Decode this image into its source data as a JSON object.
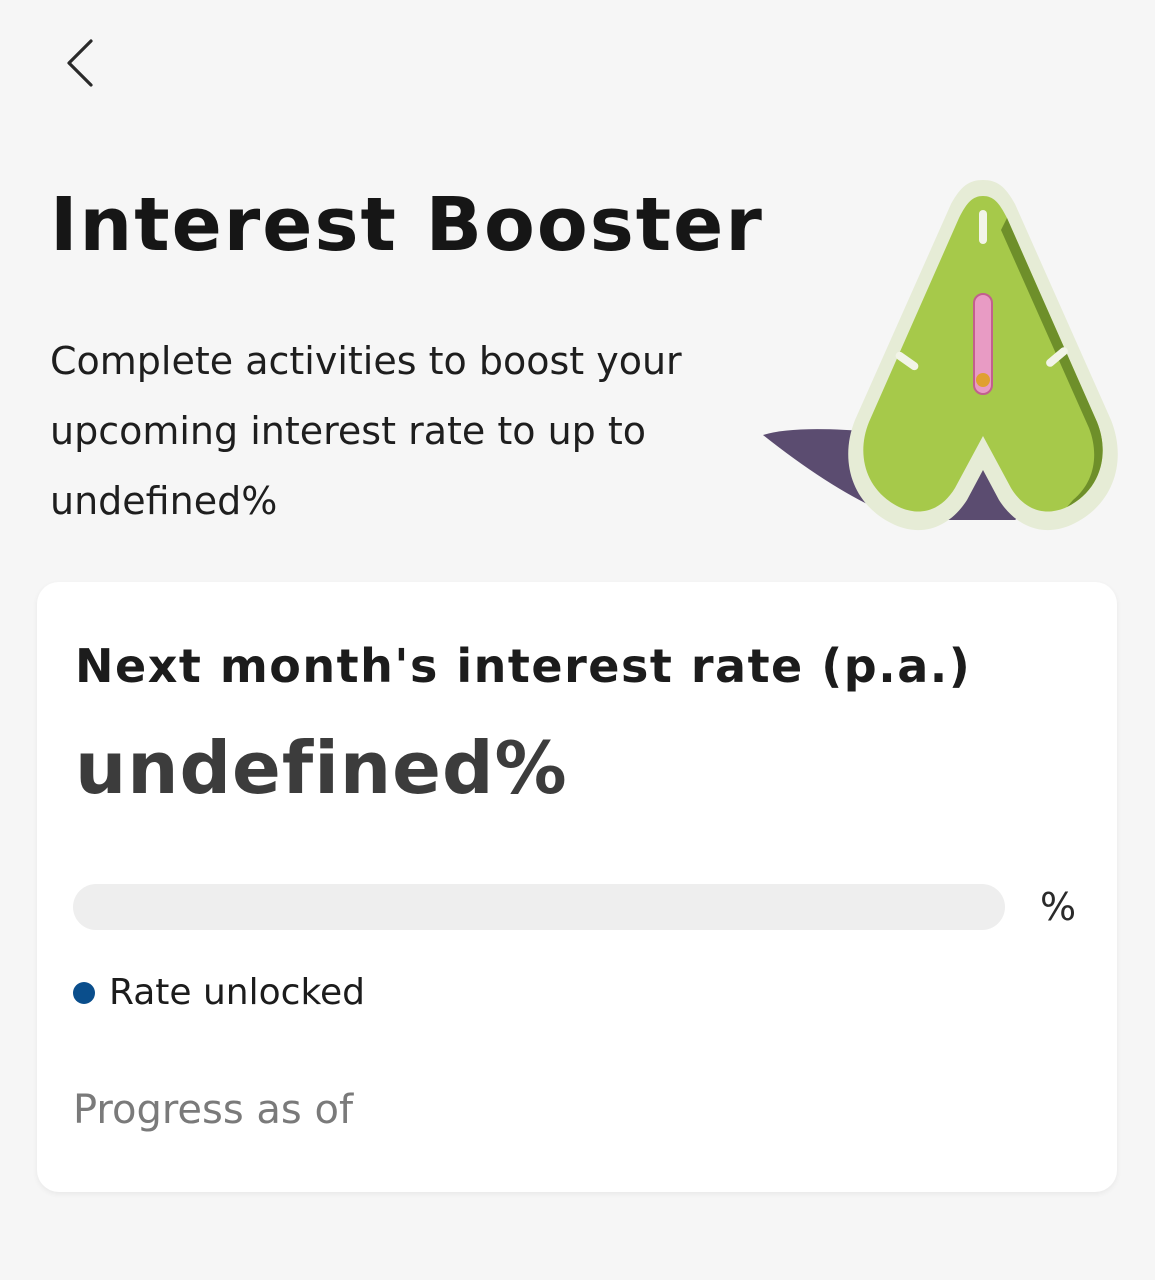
{
  "header": {
    "back_icon": "chevron-left-icon",
    "title": "Interest Booster",
    "subtitle": "Complete activities to boost your upcoming interest rate to up to undefined%"
  },
  "illustration": {
    "icon": "speedometer-a-illustration",
    "colors": {
      "green": "#a6c94a",
      "green_dark": "#6e8f2a",
      "rim": "#e6ecd6",
      "needle": "#e89bc4",
      "shadow": "#4a3a62"
    }
  },
  "rate_card": {
    "heading": "Next month's interest rate (p.a.)",
    "rate_value": "undefined%",
    "progress": {
      "fill_fraction": 0,
      "percent_label": "%",
      "track_color": "#eeeeee",
      "fill_color": "#0a4e8c"
    },
    "legend": {
      "label": "Rate unlocked",
      "dot_color": "#0a4e8c"
    },
    "progress_note": "Progress as of"
  }
}
